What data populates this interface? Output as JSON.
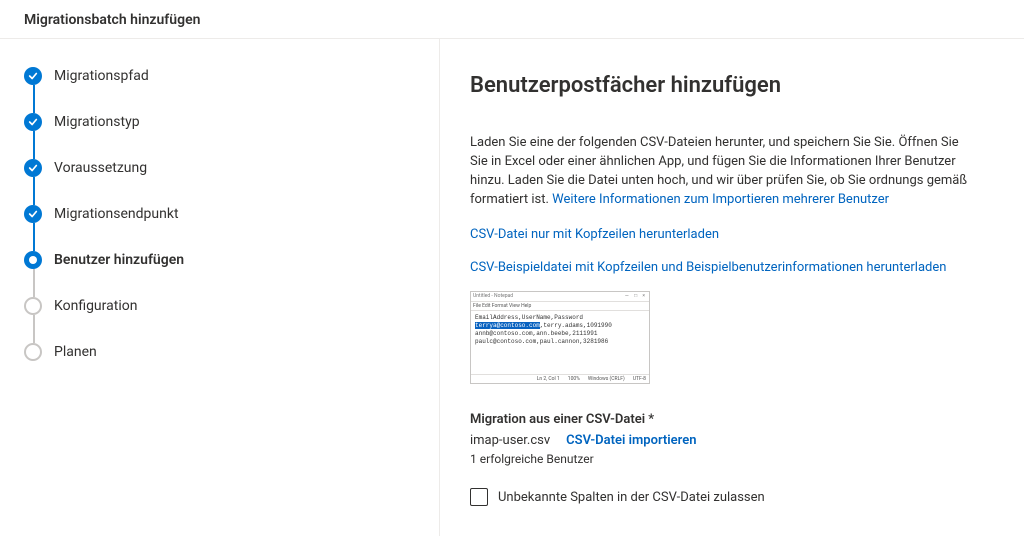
{
  "header": {
    "title": "Migrationsbatch hinzufügen"
  },
  "stepper": {
    "steps": [
      {
        "label": "Migrationspfad",
        "state": "done"
      },
      {
        "label": "Migrationstyp",
        "state": "done"
      },
      {
        "label": "Voraussetzung",
        "state": "done"
      },
      {
        "label": "Migrationsendpunkt",
        "state": "done"
      },
      {
        "label": "Benutzer hinzufügen",
        "state": "current"
      },
      {
        "label": "Konfiguration",
        "state": "todo"
      },
      {
        "label": "Planen",
        "state": "todo"
      }
    ]
  },
  "main": {
    "heading": "Benutzerpostfächer hinzufügen",
    "description_before_link": "Laden Sie eine der folgenden CSV-Dateien herunter, und speichern Sie Sie. Öffnen Sie Sie in Excel oder einer ähnlichen App, und fügen Sie die Informationen Ihrer Benutzer hinzu. Laden Sie die Datei unten hoch, und wir über prüfen Sie, ob Sie ordnungs gemäß formatiert ist. ",
    "description_link": "Weitere Informationen zum Importieren mehrerer Benutzer",
    "download_headers_only": "CSV-Datei nur mit Kopfzeilen herunterladen",
    "download_sample": "CSV-Beispieldatei mit Kopfzeilen und Beispielbenutzerinformationen herunterladen",
    "notepad": {
      "title": "Untitled - Notepad",
      "menu": "File  Edit  Format  View  Help",
      "line1": "EmailAddress,UserName,Password",
      "line2_hl": "terrya@contoso.com",
      "line2_rest": ",terry.adams,1091990",
      "line3": "annb@contoso.com,ann.beebe,2111991",
      "line4": "paulc@contoso.com,paul.cannon,3281986",
      "status": {
        "pos": "Ln 2, Col 1",
        "zoom": "100%",
        "enc": "Windows (CRLF)",
        "charset": "UTF-8"
      }
    },
    "csv_section_label": "Migration aus einer CSV-Datei *",
    "filename": "imap-user.csv",
    "import_label": "CSV-Datei importieren",
    "success_text": "1 erfolgreiche Benutzer",
    "checkbox_label": "Unbekannte Spalten in der CSV-Datei zulassen"
  },
  "colors": {
    "accent": "#0078d4",
    "link": "#0064bf"
  }
}
